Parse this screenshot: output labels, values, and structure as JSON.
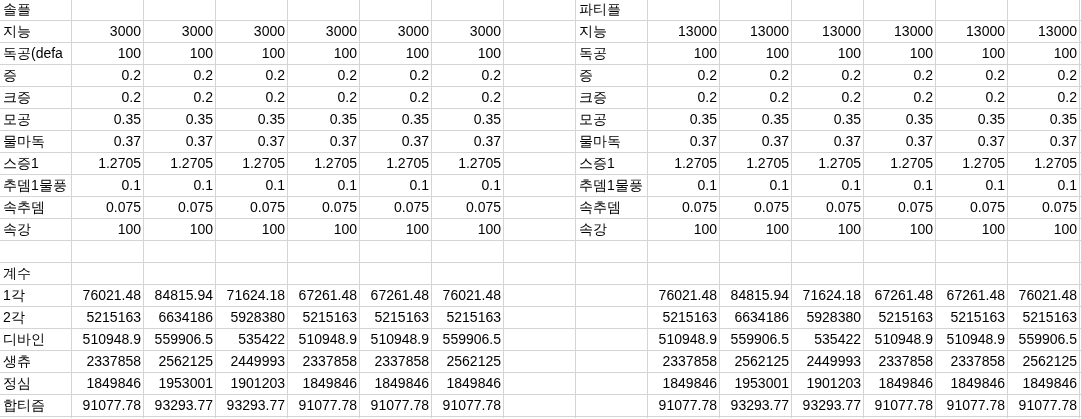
{
  "solo": {
    "title": "솔플",
    "rows": [
      {
        "label": "지능",
        "values": [
          "3000",
          "3000",
          "3000",
          "3000",
          "3000",
          "3000"
        ]
      },
      {
        "label": "독공(defa",
        "values": [
          "100",
          "100",
          "100",
          "100",
          "100",
          "100"
        ]
      },
      {
        "label": "증",
        "values": [
          "0.2",
          "0.2",
          "0.2",
          "0.2",
          "0.2",
          "0.2"
        ]
      },
      {
        "label": "크증",
        "values": [
          "0.2",
          "0.2",
          "0.2",
          "0.2",
          "0.2",
          "0.2"
        ]
      },
      {
        "label": "모공",
        "values": [
          "0.35",
          "0.35",
          "0.35",
          "0.35",
          "0.35",
          "0.35"
        ]
      },
      {
        "label": "물마독",
        "values": [
          "0.37",
          "0.37",
          "0.37",
          "0.37",
          "0.37",
          "0.37"
        ]
      },
      {
        "label": "스증1",
        "values": [
          "1.2705",
          "1.2705",
          "1.2705",
          "1.2705",
          "1.2705",
          "1.2705"
        ]
      },
      {
        "label": "추뎀1물풍",
        "values": [
          "0.1",
          "0.1",
          "0.1",
          "0.1",
          "0.1",
          "0.1"
        ]
      },
      {
        "label": "속추뎀",
        "values": [
          "0.075",
          "0.075",
          "0.075",
          "0.075",
          "0.075",
          "0.075"
        ]
      },
      {
        "label": "속강",
        "values": [
          "100",
          "100",
          "100",
          "100",
          "100",
          "100"
        ]
      }
    ]
  },
  "party": {
    "title": "파티플",
    "rows": [
      {
        "label": "지능",
        "values": [
          "13000",
          "13000",
          "13000",
          "13000",
          "13000",
          "13000"
        ]
      },
      {
        "label": "독공",
        "values": [
          "100",
          "100",
          "100",
          "100",
          "100",
          "100"
        ]
      },
      {
        "label": "증",
        "values": [
          "0.2",
          "0.2",
          "0.2",
          "0.2",
          "0.2",
          "0.2"
        ]
      },
      {
        "label": "크증",
        "values": [
          "0.2",
          "0.2",
          "0.2",
          "0.2",
          "0.2",
          "0.2"
        ]
      },
      {
        "label": "모공",
        "values": [
          "0.35",
          "0.35",
          "0.35",
          "0.35",
          "0.35",
          "0.35"
        ]
      },
      {
        "label": "물마독",
        "values": [
          "0.37",
          "0.37",
          "0.37",
          "0.37",
          "0.37",
          "0.37"
        ]
      },
      {
        "label": "스증1",
        "values": [
          "1.2705",
          "1.2705",
          "1.2705",
          "1.2705",
          "1.2705",
          "1.2705"
        ]
      },
      {
        "label": "추뎀1물풍",
        "values": [
          "0.1",
          "0.1",
          "0.1",
          "0.1",
          "0.1",
          "0.1"
        ]
      },
      {
        "label": "속추뎀",
        "values": [
          "0.075",
          "0.075",
          "0.075",
          "0.075",
          "0.075",
          "0.075"
        ]
      },
      {
        "label": "속강",
        "values": [
          "100",
          "100",
          "100",
          "100",
          "100",
          "100"
        ]
      }
    ]
  },
  "coefficients": {
    "title": "계수",
    "rows": [
      {
        "label": "1각",
        "solo_values": [
          "76021.48",
          "84815.94",
          "71624.18",
          "67261.48",
          "67261.48",
          "76021.48"
        ],
        "party_values": [
          "76021.48",
          "84815.94",
          "71624.18",
          "67261.48",
          "67261.48",
          "76021.48"
        ]
      },
      {
        "label": "2각",
        "solo_values": [
          "5215163",
          "6634186",
          "5928380",
          "5215163",
          "5215163",
          "5215163"
        ],
        "party_values": [
          "5215163",
          "6634186",
          "5928380",
          "5215163",
          "5215163",
          "5215163"
        ]
      },
      {
        "label": "디바인",
        "solo_values": [
          "510948.9",
          "559906.5",
          "535422",
          "510948.9",
          "510948.9",
          "559906.5"
        ],
        "party_values": [
          "510948.9",
          "559906.5",
          "535422",
          "510948.9",
          "510948.9",
          "559906.5"
        ]
      },
      {
        "label": "생츄",
        "solo_values": [
          "2337858",
          "2562125",
          "2449993",
          "2337858",
          "2337858",
          "2562125"
        ],
        "party_values": [
          "2337858",
          "2562125",
          "2449993",
          "2337858",
          "2337858",
          "2562125"
        ]
      },
      {
        "label": "정심",
        "solo_values": [
          "1849846",
          "1953001",
          "1901203",
          "1849846",
          "1849846",
          "1849846"
        ],
        "party_values": [
          "1849846",
          "1953001",
          "1901203",
          "1849846",
          "1849846",
          "1849846"
        ]
      },
      {
        "label": "합티즘",
        "solo_values": [
          "91077.78",
          "93293.77",
          "93293.77",
          "91077.78",
          "91077.78",
          "91077.78"
        ],
        "party_values": [
          "91077.78",
          "93293.77",
          "93293.77",
          "91077.78",
          "91077.78",
          "91077.78"
        ]
      }
    ]
  }
}
